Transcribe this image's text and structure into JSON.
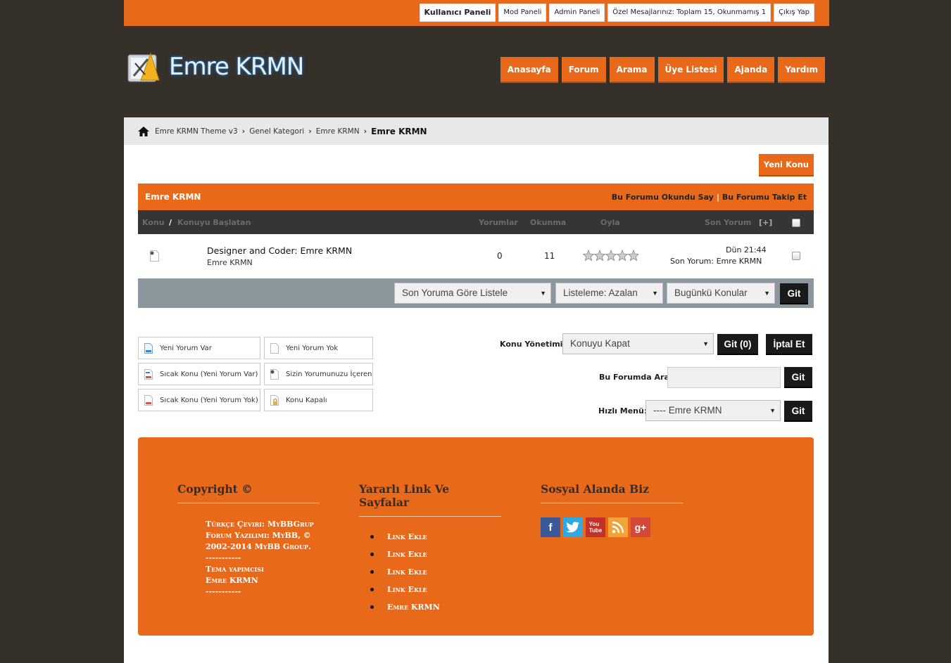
{
  "topbar": {
    "links": [
      "Kullanıcı Paneli",
      "Mod Paneli",
      "Admin Paneli",
      "Özel Mesajlarınız: Toplam 15, Okunmamış 1",
      "Çıkış Yap"
    ]
  },
  "header": {
    "logo_text": "Emre KRMN",
    "nav": [
      "Anasayfa",
      "Forum",
      "Arama",
      "Üye Listesi",
      "Ajanda",
      "Yardım"
    ]
  },
  "breadcrumb": {
    "items": [
      "Emre KRMN Theme v3",
      "Genel Kategori",
      "Emre KRMN"
    ],
    "current": "Emre KRMN"
  },
  "new_thread_label": "Yeni Konu",
  "forum": {
    "title": "Emre KRMN",
    "mark_read": "Bu Forumu Okundu Say",
    "divider": "|",
    "subscribe": "Bu Forumu Takip Et",
    "columns": {
      "topic": "Konu",
      "slash": "/",
      "starter": "Konuyu Başlatan",
      "replies": "Yorumlar",
      "views": "Okunma",
      "rating": "Oyla",
      "last_post": "Son Yorum",
      "expand": "[+]"
    },
    "threads": [
      {
        "title": "Designer and Coder: Emre KRMN",
        "author": "Emre KRMN",
        "replies": "0",
        "views": "11",
        "rating_stars": 5,
        "last_time": "Dün 21:44",
        "last_by": "Son Yorum: Emre KRMN"
      }
    ],
    "sort": {
      "sort_by": "Son Yoruma Göre Listele",
      "order": "Listeleme: Azalan",
      "cutoff": "Bugünkü Konular",
      "go": "Git"
    }
  },
  "legend": [
    "Yeni Yorum Var",
    "Yeni Yorum Yok",
    "Sıcak Konu (Yeni Yorum Var)",
    "Sizin Yorumunuzu İçeren",
    "Sıcak Konu (Yeni Yorum Yok)",
    "Konu Kapalı"
  ],
  "moderation": {
    "label": "Konu Yönetimi:",
    "selected": "Konuyu Kapat",
    "go": "Git (0)",
    "cancel": "İptal Et"
  },
  "forum_search": {
    "label": "Bu Forumda Ara:",
    "value": "",
    "go": "Git"
  },
  "jump": {
    "label": "Hızlı Menü:",
    "selected": "---- Emre KRMN",
    "go": "Git"
  },
  "footer": {
    "col1_title": "Copyright ©",
    "col1_lines": [
      "Türkçe Çeviri: MyBBGrup",
      "Forum Yazılımı: MyBB, ©",
      "2002-2014 MyBB Group.",
      "-----------",
      "Tema yapımcısı",
      "Emre KRMN",
      "-----------"
    ],
    "col2_title": "Yararlı Link Ve Sayfalar",
    "col2_links": [
      "Link Ekle",
      "Link Ekle",
      "Link Ekle",
      "Link Ekle",
      "Emre KRMN"
    ],
    "col3_title": "Sosyal Alanda Biz",
    "social": [
      "facebook-icon",
      "twitter-icon",
      "youtube-icon",
      "rss-icon",
      "google-plus-icon"
    ]
  },
  "colors": {
    "accent": "#e8691a",
    "background": "#36302a",
    "dark_header": "#353535",
    "sort_bar": "#8c979d"
  }
}
